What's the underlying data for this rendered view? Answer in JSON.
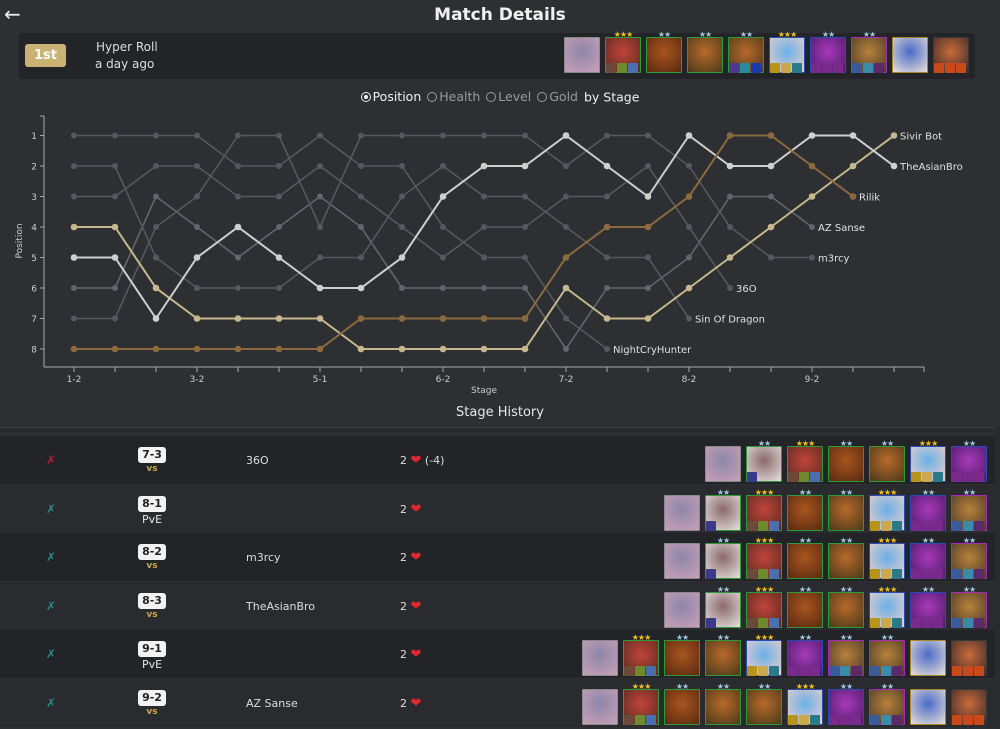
{
  "header": {
    "title": "Match Details",
    "back_icon": "arrow-left-icon"
  },
  "summary": {
    "placement": "1st",
    "mode": "Hyper Roll",
    "time_ago": "a day ago",
    "composition": [
      {
        "champ": "Poppy",
        "stars": 0,
        "border": "#8a8a8a",
        "colors": [
          "#8d86a8",
          "#c9a0b8"
        ],
        "items": []
      },
      {
        "champ": "Swain",
        "stars": 3,
        "star_color": "#f2c21b",
        "border": "#2e9b3a",
        "colors": [
          "#c0443a",
          "#5a2a20"
        ],
        "items": [
          "#6b4a3a",
          "#6f8a2c",
          "#4a6fae"
        ]
      },
      {
        "champ": "Taliyah",
        "stars": 2,
        "star_color": "#9ec7de",
        "border": "#2e9b3a",
        "colors": [
          "#a8551e",
          "#5a2a10"
        ],
        "items": []
      },
      {
        "champ": "Teemo",
        "stars": 2,
        "star_color": "#9ec7de",
        "border": "#2e9b3a",
        "colors": [
          "#b8692a",
          "#4a3a1a"
        ],
        "items": []
      },
      {
        "champ": "Teemo",
        "stars": 2,
        "star_color": "#9ec7de",
        "border": "#2e9b3a",
        "colors": [
          "#b8692a",
          "#4a3a1a"
        ],
        "items": [
          "#4a3a8a",
          "#2a8a9a",
          "#1a3aaa"
        ]
      },
      {
        "champ": "Gwen",
        "stars": 3,
        "star_color": "#f2c21b",
        "border": "#2a4ab8",
        "colors": [
          "#6ab0e8",
          "#f0d0c8"
        ],
        "items": [
          "#b8941a",
          "#c9a84e",
          "#2a7a8a"
        ]
      },
      {
        "champ": "Vel'Koz",
        "stars": 2,
        "star_color": "#9ec7de",
        "border": "#2a4ab8",
        "colors": [
          "#a83ab8",
          "#4a1a6a"
        ],
        "items": [
          "#7a2a8a",
          "#7a2a8a",
          "#7a2a8a"
        ]
      },
      {
        "champ": "Jarvan",
        "stars": 2,
        "star_color": "#9ec7de",
        "border": "#a82ab8",
        "colors": [
          "#b8823a",
          "#4a3a2a"
        ],
        "items": [
          "#3a5a9a",
          "#3a8aaa",
          "#5a2a6a"
        ]
      },
      {
        "champ": "Heimerdinger",
        "stars": 0,
        "border": "#a8862a",
        "colors": [
          "#4a6ac8",
          "#e8e0d8"
        ],
        "items": []
      },
      {
        "champ": "Jinx",
        "stars": 0,
        "border": "#3a3a3a",
        "colors": [
          "#c86a3a",
          "#3a2a2a"
        ],
        "items": [
          "#c84a1a",
          "#c84a1a",
          "#c84a1a"
        ]
      }
    ]
  },
  "graph_options": {
    "options": [
      {
        "label": "Position",
        "selected": true
      },
      {
        "label": "Health",
        "selected": false
      },
      {
        "label": "Level",
        "selected": false
      },
      {
        "label": "Gold",
        "selected": false
      }
    ],
    "suffix": "by Stage"
  },
  "chart_data": {
    "type": "line",
    "title": "Position by Stage",
    "xlabel": "Stage",
    "ylabel": "Position",
    "x_tick_labels": [
      "1-2",
      "",
      "",
      "3-2",
      "",
      "",
      "5-1",
      "",
      "",
      "6-2",
      "",
      "",
      "7-2",
      "",
      "",
      "8-2",
      "",
      "",
      "9-2",
      "",
      ""
    ],
    "y_ticks": [
      1,
      2,
      3,
      4,
      5,
      6,
      7,
      8
    ],
    "ylim": [
      8.6,
      0.6
    ],
    "y_inverted": true,
    "grid": false,
    "series": [
      {
        "name": "Sivir Bot",
        "color": "#c5b88e",
        "highlight": true,
        "values": [
          4,
          4,
          6,
          7,
          7,
          7,
          7,
          8,
          8,
          8,
          8,
          8,
          6,
          7,
          7,
          6,
          5,
          4,
          3,
          2,
          1
        ]
      },
      {
        "name": "TheAsianBro",
        "color": "#cfcfcf",
        "highlight": true,
        "values": [
          5,
          5,
          7,
          5,
          4,
          5,
          6,
          6,
          5,
          3,
          2,
          2,
          1,
          2,
          3,
          1,
          2,
          2,
          1,
          1,
          2
        ]
      },
      {
        "name": "Rilik",
        "color": "#8a6a3e",
        "highlight": true,
        "values": [
          8,
          8,
          8,
          8,
          8,
          8,
          8,
          7,
          7,
          7,
          7,
          7,
          5,
          4,
          4,
          3,
          1,
          1,
          2,
          3
        ]
      },
      {
        "name": "AZ Sanse",
        "color": "#62666b",
        "highlight": false,
        "values": [
          6,
          6,
          3,
          4,
          5,
          4,
          3,
          4,
          6,
          6,
          6,
          6,
          8,
          6,
          6,
          5,
          3,
          3,
          4
        ]
      },
      {
        "name": "m3rcy",
        "color": "#55585c",
        "highlight": false,
        "values": [
          7,
          7,
          4,
          3,
          1,
          1,
          4,
          1,
          1,
          1,
          1,
          1,
          2,
          1,
          1,
          2,
          4,
          5,
          5
        ]
      },
      {
        "name": "36O",
        "color": "#55585c",
        "highlight": false,
        "values": [
          3,
          3,
          2,
          2,
          3,
          3,
          2,
          3,
          4,
          5,
          4,
          4,
          3,
          3,
          2,
          4,
          6
        ]
      },
      {
        "name": "Sin Of Dragon",
        "color": "#55585c",
        "highlight": false,
        "values": [
          2,
          2,
          5,
          6,
          6,
          6,
          5,
          5,
          3,
          2,
          3,
          3,
          4,
          5,
          5,
          7
        ]
      },
      {
        "name": "NightCryHunter",
        "color": "#55585c",
        "highlight": false,
        "values": [
          1,
          1,
          1,
          1,
          2,
          2,
          1,
          2,
          2,
          4,
          5,
          5,
          7,
          8
        ]
      }
    ]
  },
  "history": {
    "title": "Stage History",
    "rows": [
      {
        "result": "loss",
        "stage": "7-3",
        "kind": "vs",
        "opponent": "36O",
        "health": "2",
        "delta": "(-4)",
        "units": [
          "Poppy",
          "Warwick",
          "Swain",
          "Taliyah",
          "Teemo",
          "Gwen",
          "Vel'Koz"
        ]
      },
      {
        "result": "win",
        "stage": "8-1",
        "kind": "PvE",
        "opponent": "",
        "health": "2",
        "delta": "",
        "units": [
          "Poppy",
          "Warwick",
          "Swain",
          "Taliyah",
          "Teemo",
          "Gwen",
          "Vel'Koz",
          "Jarvan"
        ]
      },
      {
        "result": "win",
        "stage": "8-2",
        "kind": "vs",
        "opponent": "m3rcy",
        "health": "2",
        "delta": "",
        "units": [
          "Poppy",
          "Warwick",
          "Swain",
          "Taliyah",
          "Teemo",
          "Gwen",
          "Vel'Koz",
          "Jarvan"
        ]
      },
      {
        "result": "win",
        "stage": "8-3",
        "kind": "vs",
        "opponent": "TheAsianBro",
        "health": "2",
        "delta": "",
        "units": [
          "Poppy",
          "Warwick",
          "Swain",
          "Taliyah",
          "Teemo",
          "Gwen",
          "Vel'Koz",
          "Jarvan"
        ]
      },
      {
        "result": "win",
        "stage": "9-1",
        "kind": "PvE",
        "opponent": "",
        "health": "2",
        "delta": "",
        "units": [
          "Poppy",
          "Swain",
          "Taliyah",
          "Teemo",
          "Gwen",
          "Vel'Koz",
          "Jarvan",
          "Jarvan",
          "Heimerdinger",
          "Jinx"
        ]
      },
      {
        "result": "win",
        "stage": "9-2",
        "kind": "vs",
        "opponent": "AZ Sanse",
        "health": "2",
        "delta": "",
        "units": [
          "Poppy",
          "Swain",
          "Taliyah",
          "Teemo",
          "Teemo",
          "Gwen",
          "Vel'Koz",
          "Jarvan",
          "Heimerdinger",
          "Jinx"
        ]
      }
    ],
    "result_colors": {
      "win": "#2a8a8a",
      "loss": "#b01e3a"
    }
  }
}
